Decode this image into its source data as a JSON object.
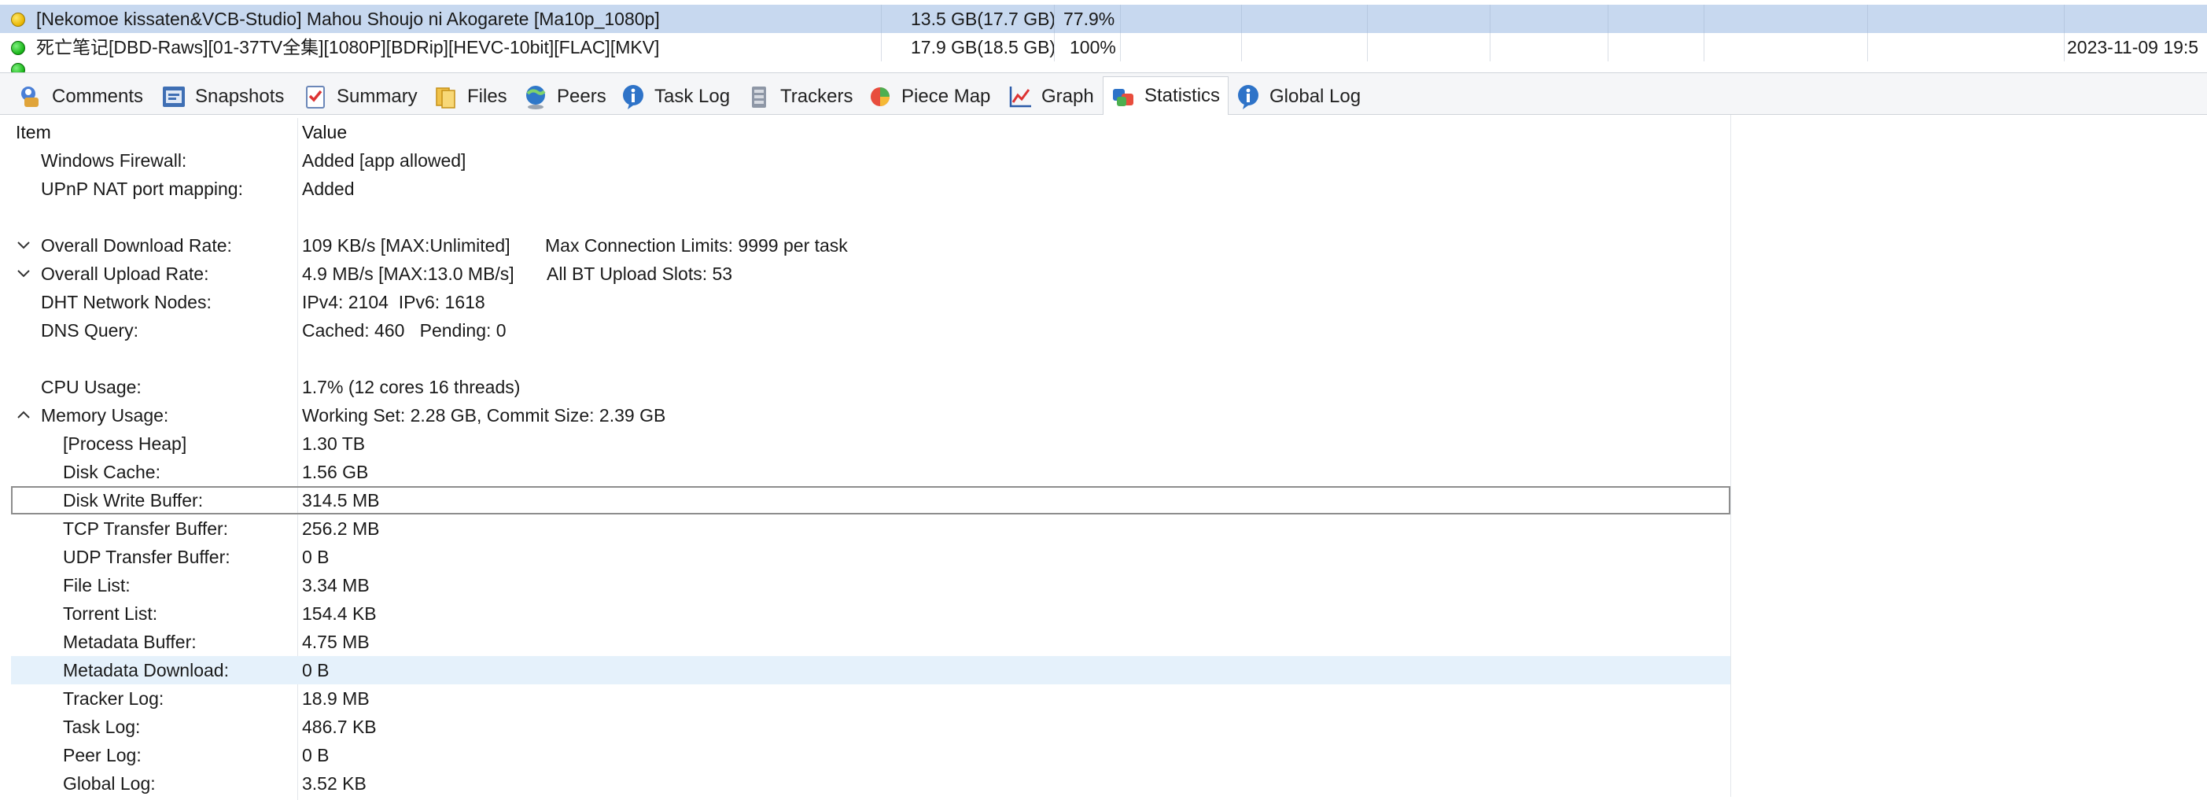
{
  "task_list": {
    "rows": [
      {
        "status": "yellow",
        "name": "[Nekomoe kissaten&VCB-Studio] Mahou Shoujo ni Akogarete [Ma10p_1080p]",
        "size": "13.5 GB(17.7 GB)",
        "progress": "77.9%",
        "date": ""
      },
      {
        "status": "green",
        "name": "死亡笔记[DBD-Raws][01-37TV全集][1080P][BDRip][HEVC-10bit][FLAC][MKV]",
        "size": "17.9 GB(18.5 GB)",
        "progress": "100%",
        "date": "2023-11-09 19:5"
      },
      {
        "status": "green",
        "name": "",
        "size": "",
        "progress": "",
        "date": ""
      }
    ]
  },
  "tabs": [
    {
      "label": "Comments",
      "icon": "comments-icon"
    },
    {
      "label": "Snapshots",
      "icon": "snapshots-icon"
    },
    {
      "label": "Summary",
      "icon": "summary-icon"
    },
    {
      "label": "Files",
      "icon": "files-icon"
    },
    {
      "label": "Peers",
      "icon": "peers-icon"
    },
    {
      "label": "Task Log",
      "icon": "info-icon"
    },
    {
      "label": "Trackers",
      "icon": "trackers-icon"
    },
    {
      "label": "Piece Map",
      "icon": "piece-map-icon"
    },
    {
      "label": "Graph",
      "icon": "graph-icon"
    },
    {
      "label": "Statistics",
      "icon": "statistics-icon",
      "active": true
    },
    {
      "label": "Global Log",
      "icon": "info-icon"
    }
  ],
  "statistics": {
    "header": {
      "item": "Item",
      "value": "Value"
    },
    "rows": [
      {
        "label": "Windows Firewall:",
        "value": "Added [app allowed]",
        "indent": 1
      },
      {
        "label": "UPnP NAT port mapping:",
        "value": "Added",
        "indent": 1
      },
      {
        "label": "",
        "value": "",
        "indent": 0
      },
      {
        "label": "Overall Download Rate:",
        "value": "109 KB/s [MAX:Unlimited]",
        "extra": "Max Connection Limits: 9999 per task",
        "indent": 1,
        "toggle": "collapsed"
      },
      {
        "label": "Overall Upload Rate:",
        "value": "4.9 MB/s [MAX:13.0 MB/s]",
        "extra": "All BT Upload Slots: 53",
        "indent": 1,
        "toggle": "collapsed"
      },
      {
        "label": "DHT Network Nodes:",
        "value": "IPv4: 2104  IPv6: 1618",
        "indent": 1
      },
      {
        "label": "DNS Query:",
        "value": "Cached: 460   Pending: 0",
        "indent": 1
      },
      {
        "label": "",
        "value": "",
        "indent": 0
      },
      {
        "label": "CPU Usage:",
        "value": "1.7% (12 cores 16 threads)",
        "indent": 1
      },
      {
        "label": "Memory Usage:",
        "value": "Working Set: 2.28 GB, Commit Size: 2.39 GB",
        "indent": 1,
        "toggle": "expanded"
      },
      {
        "label": "[Process Heap]",
        "value": "1.30 TB",
        "indent": 2
      },
      {
        "label": "Disk Cache:",
        "value": "1.56 GB",
        "indent": 2
      },
      {
        "label": "Disk Write Buffer:",
        "value": "314.5 MB",
        "indent": 2,
        "state": "focused"
      },
      {
        "label": "TCP Transfer Buffer:",
        "value": "256.2 MB",
        "indent": 2
      },
      {
        "label": "UDP Transfer Buffer:",
        "value": "0 B",
        "indent": 2
      },
      {
        "label": "File List:",
        "value": "3.34 MB",
        "indent": 2
      },
      {
        "label": "Torrent List:",
        "value": "154.4 KB",
        "indent": 2
      },
      {
        "label": "Metadata Buffer:",
        "value": "4.75 MB",
        "indent": 2
      },
      {
        "label": "Metadata Download:",
        "value": "0 B",
        "indent": 2,
        "state": "hover"
      },
      {
        "label": "Tracker Log:",
        "value": "18.9 MB",
        "indent": 2
      },
      {
        "label": "Task Log:",
        "value": "486.7 KB",
        "indent": 2
      },
      {
        "label": "Peer Log:",
        "value": "0 B",
        "indent": 2
      },
      {
        "label": "Global Log:",
        "value": "3.52 KB",
        "indent": 2
      }
    ]
  },
  "colors": {
    "selected_row": "#c7d8ef",
    "hover_row": "#e5f1fb",
    "status_yellow": "#e8b400",
    "status_green": "#16b416"
  }
}
